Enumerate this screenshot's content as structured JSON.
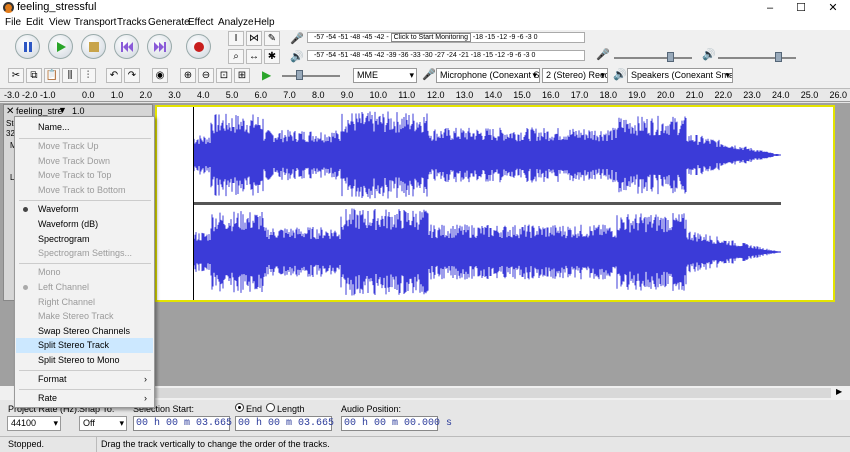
{
  "window": {
    "title": "feeling_stressful",
    "minimize": "–",
    "maximize": "☐",
    "close": "✕"
  },
  "menubar": [
    "File",
    "Edit",
    "View",
    "Transport",
    "Tracks",
    "Generate",
    "Effect",
    "Analyze",
    "Help"
  ],
  "meters": {
    "record_scale": "-57 -54 -51 -48 -45 -42 -",
    "record_prompt": "Click to Start Monitoring",
    "record_scale_end": "-18 -15 -12 -9 -6 -3 0",
    "play_scale": "-57 -54 -51 -48 -45 -42 -39 -36 -33 -30 -27 -24 -21 -18 -15 -12 -9 -6 -3 0"
  },
  "devices": {
    "host": "MME",
    "input": "Microphone (Conexant Sr",
    "channels": "2 (Stereo) Reco",
    "output": "Speakers (Conexant Smar"
  },
  "ruler": {
    "start": "-3.0 -2.0 -1.0",
    "ticks": [
      "0.0",
      "1.0",
      "2.0",
      "3.0",
      "4.0",
      "5.0",
      "6.0",
      "7.0",
      "8.0",
      "9.0",
      "10.0",
      "11.0",
      "12.0",
      "13.0",
      "14.0",
      "15.0",
      "16.0",
      "17.0",
      "18.0",
      "19.0",
      "20.0",
      "21.0",
      "22.0",
      "23.0",
      "24.0",
      "25.0",
      "26.0"
    ]
  },
  "track": {
    "name": "feeling_stre",
    "scale_top": "1.0",
    "info_lines": [
      "Ste",
      "32",
      "M",
      "L"
    ]
  },
  "context_menu": {
    "name": "Name...",
    "move_up": "Move Track Up",
    "move_down": "Move Track Down",
    "move_top": "Move Track to Top",
    "move_bottom": "Move Track to Bottom",
    "waveform": "Waveform",
    "waveform_db": "Waveform (dB)",
    "spectrogram": "Spectrogram",
    "spectrogram_settings": "Spectrogram Settings...",
    "mono": "Mono",
    "left_channel": "Left Channel",
    "right_channel": "Right Channel",
    "make_stereo": "Make Stereo Track",
    "swap_stereo": "Swap Stereo Channels",
    "split_stereo": "Split Stereo Track",
    "split_to_mono": "Split Stereo to Mono",
    "format": "Format",
    "rate": "Rate"
  },
  "bottom": {
    "project_rate_label": "Project Rate (Hz):",
    "project_rate": "44100",
    "snap_label": "Snap To:",
    "snap": "Off",
    "selection_start_label": "Selection Start:",
    "end_label": "End",
    "length_label": "Length",
    "start_time": "00 h 00 m 03.665 s",
    "end_time": "00 h 00 m 03.665 s",
    "audio_position_label": "Audio Position:",
    "audio_position": "00 h 00 m 00.000 s"
  },
  "status": {
    "state": "Stopped.",
    "message": "Drag the track vertically to change the order of the tracks."
  },
  "colors": {
    "wave": "#3b3bd8",
    "selection_border": "#e4e400",
    "menu_highlight": "#cce8ff"
  }
}
